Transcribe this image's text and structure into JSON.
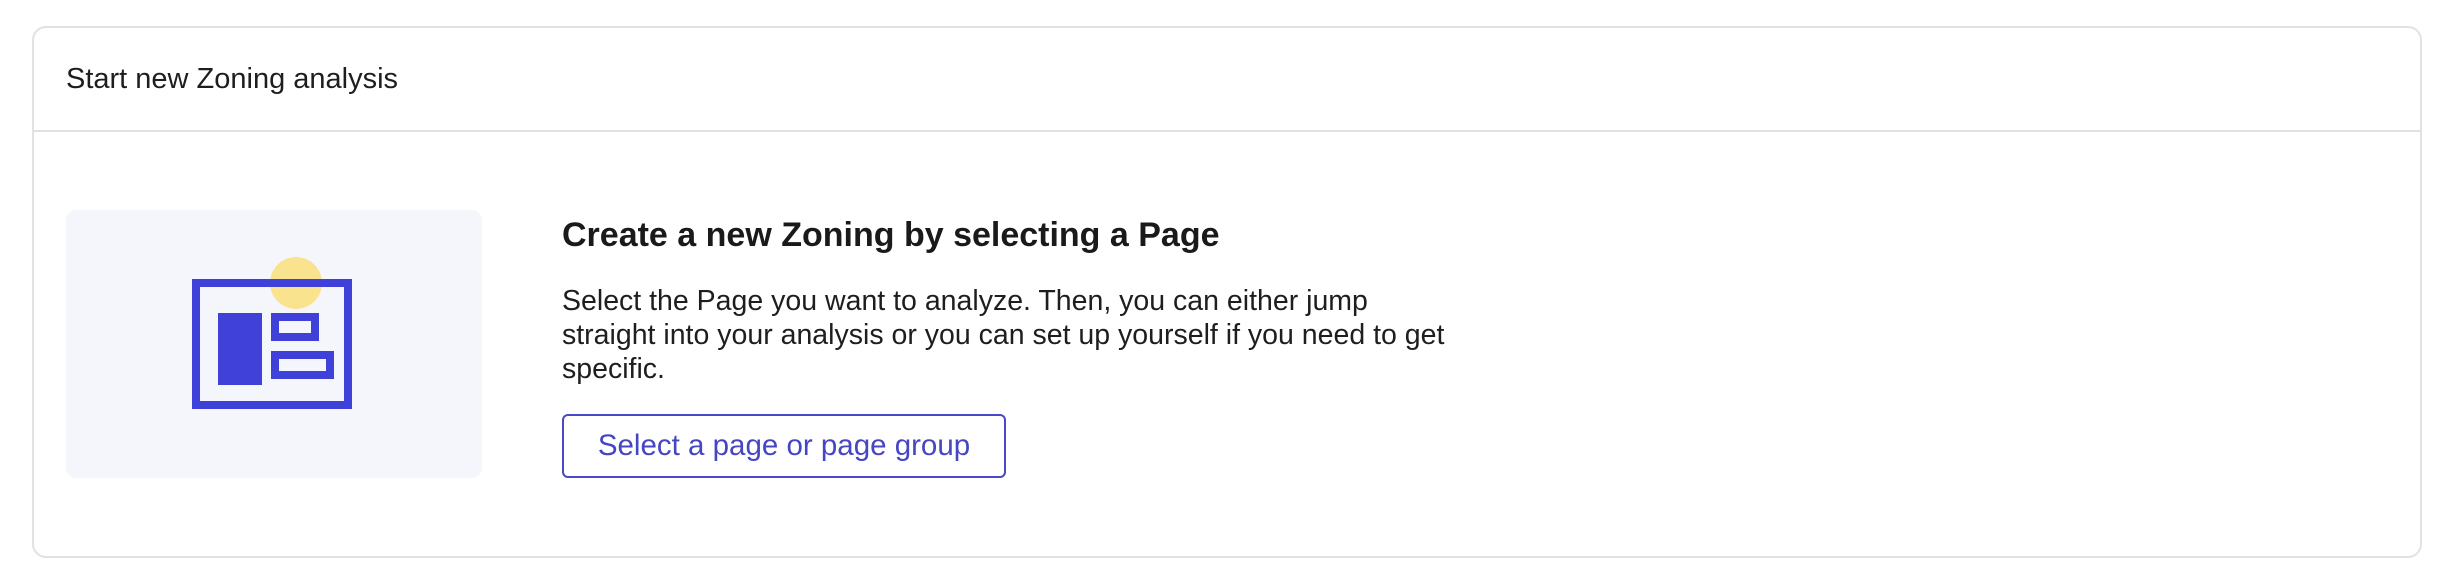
{
  "header": {
    "title": "Start new Zoning analysis"
  },
  "empty_state": {
    "illustration_icon": "page-layout-icon",
    "heading": "Create a new Zoning by selecting a Page",
    "description": "Select the Page you want to analyze. Then, you can either jump straight into your analysis or you can set up yourself if you need to get specific.",
    "button_label": "Select a page or page group"
  },
  "colors": {
    "accent": "#3f41d9",
    "highlight": "#f9e38f",
    "illustration_bg": "#f5f6fb",
    "border": "#e2e2e6"
  }
}
